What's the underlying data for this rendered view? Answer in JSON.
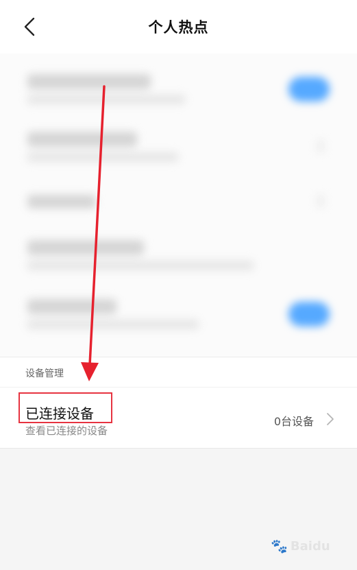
{
  "header": {
    "title": "个人热点",
    "back_icon": "chevron-left-icon"
  },
  "device_management": {
    "section_title": "设备管理",
    "connected_devices": {
      "title": "已连接设备",
      "subtitle": "查看已连接的设备",
      "value": "0台设备",
      "chevron_icon": "chevron-right-icon"
    }
  },
  "annotation": {
    "arrow_color": "#e6212e",
    "highlight_color": "#e63340"
  },
  "watermark": {
    "brand": "Baidu"
  },
  "colors": {
    "toggle_blue": "#56a9ff",
    "background": "#f5f5f5"
  }
}
